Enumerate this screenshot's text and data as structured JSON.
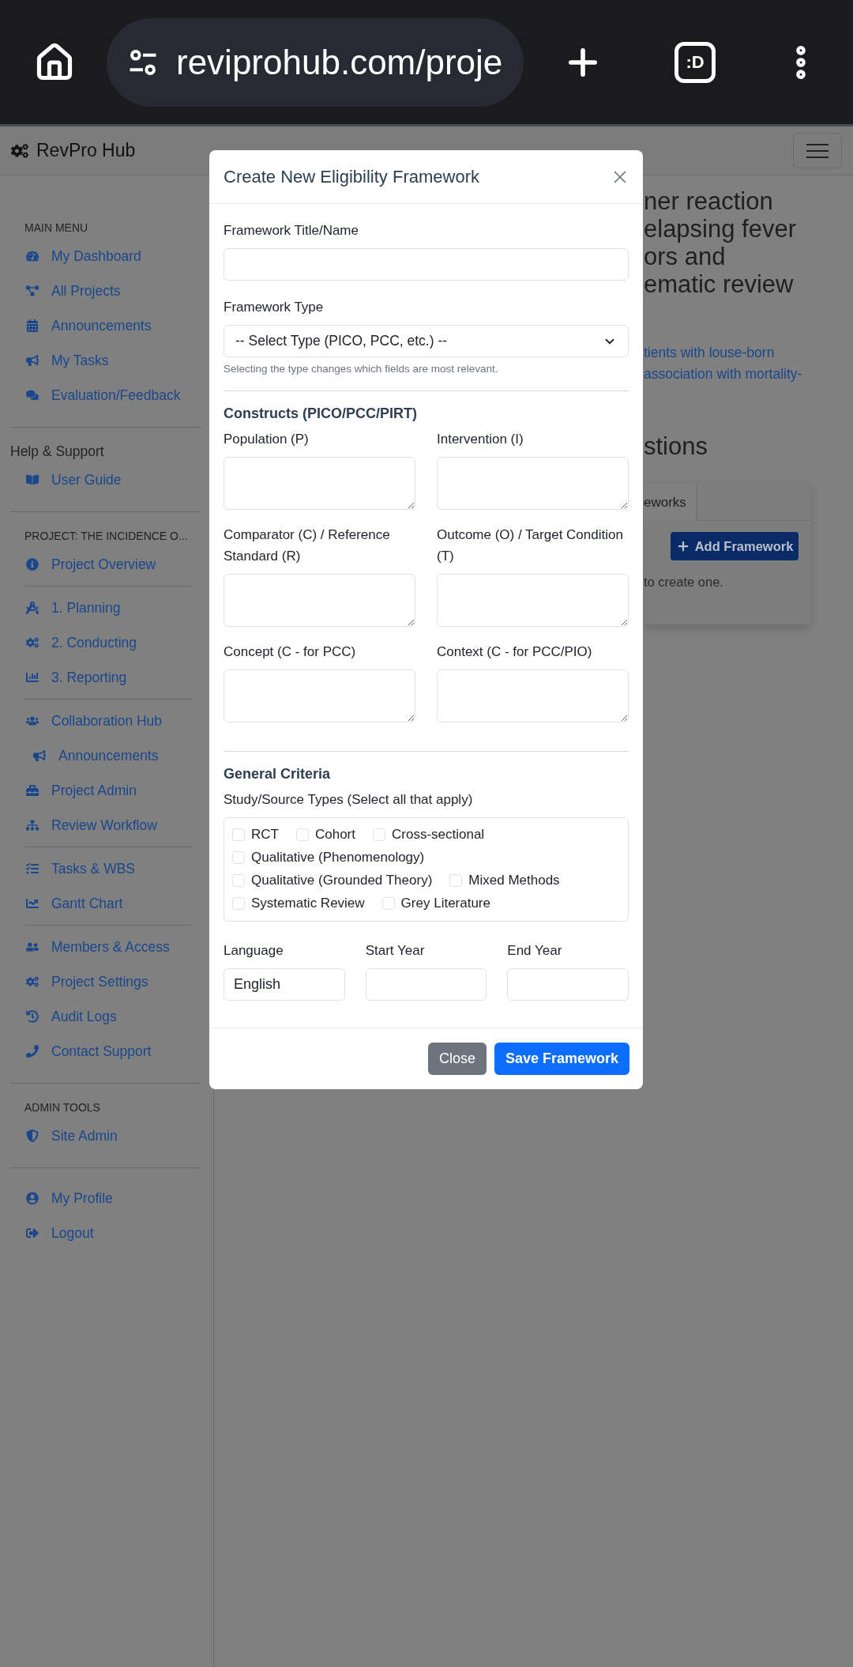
{
  "browser": {
    "url": "reviprohub.com/proje",
    "tab_switcher": ":D"
  },
  "navbar": {
    "brand": "RevPro Hub"
  },
  "sidebar": {
    "sections": [
      {
        "heading": "MAIN MENU",
        "kind": "caps",
        "groups": [
          {
            "items": [
              {
                "label": "My Dashboard"
              },
              {
                "label": "All Projects"
              },
              {
                "label": "Announcements"
              },
              {
                "label": "My Tasks"
              },
              {
                "label": "Evaluation/Feedback"
              }
            ]
          }
        ]
      },
      {
        "heading": "Help & Support",
        "kind": "plain",
        "groups": [
          {
            "items": [
              {
                "label": "User Guide"
              }
            ]
          }
        ]
      },
      {
        "heading": "PROJECT: THE INCIDENCE O...",
        "kind": "caps",
        "groups": [
          {
            "items": [
              {
                "label": "Project Overview"
              }
            ]
          },
          {
            "items": [
              {
                "label": "1. Planning"
              },
              {
                "label": "2. Conducting"
              },
              {
                "label": "3. Reporting"
              }
            ]
          },
          {
            "items": [
              {
                "label": "Collaboration Hub",
                "children": [
                  {
                    "label": "Announcements"
                  }
                ]
              },
              {
                "label": "Project Admin"
              },
              {
                "label": "Review Workflow"
              }
            ]
          },
          {
            "items": [
              {
                "label": "Tasks & WBS"
              },
              {
                "label": "Gantt Chart"
              }
            ]
          },
          {
            "items": [
              {
                "label": "Members & Access"
              },
              {
                "label": "Project Settings"
              },
              {
                "label": "Audit Logs"
              },
              {
                "label": "Contact Support"
              }
            ]
          }
        ]
      },
      {
        "heading": "ADMIN TOOLS",
        "kind": "caps",
        "groups": [
          {
            "items": [
              {
                "label": "Site Admin"
              }
            ]
          }
        ]
      },
      {
        "groups": [
          {
            "items": [
              {
                "label": "My Profile"
              },
              {
                "label": "Logout"
              }
            ]
          }
        ]
      }
    ]
  },
  "main": {
    "title_lines": [
      "ner reaction",
      "elapsing fever",
      "ors and",
      "ematic review"
    ],
    "link_lines": [
      "tients with louse-born",
      "association with mortality-"
    ],
    "section_title": "stions",
    "tab": "eworks",
    "add_button": "Add Framework",
    "empty_text": "to create one."
  },
  "modal": {
    "title": "Create New Eligibility Framework",
    "fields": [
      {
        "label": "Framework Title/Name",
        "kind": "text"
      },
      {
        "label": "Framework Type",
        "kind": "select",
        "value": "-- Select Type (PICO, PCC, etc.) --",
        "help": "Selecting the type changes which fields are most relevant."
      }
    ],
    "constructs": {
      "heading": "Constructs (PICO/PCC/PIRT)",
      "fields": [
        {
          "label": "Population (P)"
        },
        {
          "label": "Intervention (I)"
        },
        {
          "label": "Comparator (C) / Reference Standard (R)"
        },
        {
          "label": "Outcome (O) / Target Condition (T)"
        },
        {
          "label": "Concept (C - for PCC)"
        },
        {
          "label": "Context (C - for PCC/PIO)"
        }
      ]
    },
    "general": {
      "heading": "General Criteria",
      "study_types_label": "Study/Source Types (Select all that apply)",
      "study_types": [
        {
          "label": "RCT",
          "checked": false
        },
        {
          "label": "Cohort",
          "checked": false
        },
        {
          "label": "Cross-sectional",
          "checked": false
        },
        {
          "label": "Qualitative (Phenomenology)",
          "checked": false
        },
        {
          "label": "Qualitative (Grounded Theory)",
          "checked": false
        },
        {
          "label": "Mixed Methods",
          "checked": false
        },
        {
          "label": "Systematic Review",
          "checked": false
        },
        {
          "label": "Grey Literature",
          "checked": false
        }
      ],
      "fields": [
        {
          "label": "Language",
          "value": "English"
        },
        {
          "label": "Start Year"
        },
        {
          "label": "End Year"
        }
      ]
    },
    "buttons": [
      {
        "label": "Close",
        "kind": "secondary"
      },
      {
        "label": "Save Framework",
        "kind": "primary"
      }
    ]
  }
}
